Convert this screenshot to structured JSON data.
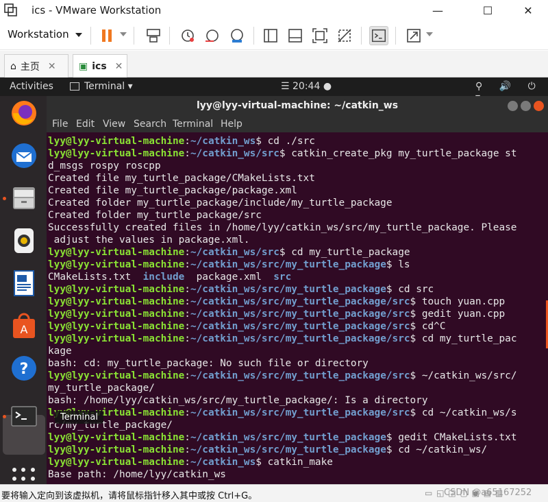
{
  "window": {
    "title": "ics - VMware Workstation"
  },
  "toolbar": {
    "workstation_label": "Workstation"
  },
  "tabs": [
    {
      "label": "主页",
      "close": "✕"
    },
    {
      "label": "ics",
      "close": "✕"
    }
  ],
  "ubuntu": {
    "activities": "Activities",
    "app_menu": "Terminal ▾",
    "clock": "20:44",
    "tray": "⚲ 🔊 ⏻ ▾"
  },
  "dock": {
    "tooltip": "Terminal"
  },
  "terminal": {
    "title": "lyy@lyy-virtual-machine: ~/catkin_ws",
    "menu": [
      "File",
      "Edit",
      "View",
      "Search",
      "Terminal",
      "Help"
    ],
    "lines": [
      [
        [
          "u",
          "lyy@lyy-virtual-machine"
        ],
        [
          "t",
          ":"
        ],
        [
          "p",
          "~/catkin_ws"
        ],
        [
          "t",
          "$ cd ./src"
        ]
      ],
      [
        [
          "u",
          "lyy@lyy-virtual-machine"
        ],
        [
          "t",
          ":"
        ],
        [
          "p",
          "~/catkin_ws/src"
        ],
        [
          "t",
          "$ catkin_create_pkg my_turtle_package st"
        ]
      ],
      [
        [
          "t",
          "d_msgs rospy roscpp"
        ]
      ],
      [
        [
          "t",
          "Created file my_turtle_package/CMakeLists.txt"
        ]
      ],
      [
        [
          "t",
          "Created file my_turtle_package/package.xml"
        ]
      ],
      [
        [
          "t",
          "Created folder my_turtle_package/include/my_turtle_package"
        ]
      ],
      [
        [
          "t",
          "Created folder my_turtle_package/src"
        ]
      ],
      [
        [
          "t",
          "Successfully created files in /home/lyy/catkin_ws/src/my_turtle_package. Please"
        ]
      ],
      [
        [
          "t",
          " adjust the values in package.xml."
        ]
      ],
      [
        [
          "u",
          "lyy@lyy-virtual-machine"
        ],
        [
          "t",
          ":"
        ],
        [
          "p",
          "~/catkin_ws/src"
        ],
        [
          "t",
          "$ cd my_turtle_package"
        ]
      ],
      [
        [
          "u",
          "lyy@lyy-virtual-machine"
        ],
        [
          "t",
          ":"
        ],
        [
          "p",
          "~/catkin_ws/src/my_turtle_package"
        ],
        [
          "t",
          "$ ls"
        ]
      ],
      [
        [
          "t",
          "CMakeLists.txt  "
        ],
        [
          "d",
          "include"
        ],
        [
          "t",
          "  package.xml  "
        ],
        [
          "d",
          "src"
        ]
      ],
      [
        [
          "u",
          "lyy@lyy-virtual-machine"
        ],
        [
          "t",
          ":"
        ],
        [
          "p",
          "~/catkin_ws/src/my_turtle_package"
        ],
        [
          "t",
          "$ cd src"
        ]
      ],
      [
        [
          "u",
          "lyy@lyy-virtual-machine"
        ],
        [
          "t",
          ":"
        ],
        [
          "p",
          "~/catkin_ws/src/my_turtle_package/src"
        ],
        [
          "t",
          "$ touch yuan.cpp"
        ]
      ],
      [
        [
          "u",
          "lyy@lyy-virtual-machine"
        ],
        [
          "t",
          ":"
        ],
        [
          "p",
          "~/catkin_ws/src/my_turtle_package/src"
        ],
        [
          "t",
          "$ gedit yuan.cpp"
        ]
      ],
      [
        [
          "u",
          "lyy@lyy-virtual-machine"
        ],
        [
          "t",
          ":"
        ],
        [
          "p",
          "~/catkin_ws/src/my_turtle_package/src"
        ],
        [
          "t",
          "$ cd^C"
        ]
      ],
      [
        [
          "u",
          "lyy@lyy-virtual-machine"
        ],
        [
          "t",
          ":"
        ],
        [
          "p",
          "~/catkin_ws/src/my_turtle_package/src"
        ],
        [
          "t",
          "$ cd my_turtle_pac"
        ]
      ],
      [
        [
          "t",
          "kage"
        ]
      ],
      [
        [
          "t",
          "bash: cd: my_turtle_package: No such file or directory"
        ]
      ],
      [
        [
          "u",
          "lyy@lyy-virtual-machine"
        ],
        [
          "t",
          ":"
        ],
        [
          "p",
          "~/catkin_ws/src/my_turtle_package/src"
        ],
        [
          "t",
          "$ ~/catkin_ws/src/"
        ]
      ],
      [
        [
          "t",
          "my_turtle_package/"
        ]
      ],
      [
        [
          "t",
          "bash: /home/lyy/catkin_ws/src/my_turtle_package/: Is a directory"
        ]
      ],
      [
        [
          "u",
          "lyy@lyy-virtual-machine"
        ],
        [
          "t",
          ":"
        ],
        [
          "p",
          "~/catkin_ws/src/my_turtle_package/src"
        ],
        [
          "t",
          "$ cd ~/catkin_ws/s"
        ]
      ],
      [
        [
          "t",
          "rc/my_turtle_package/"
        ]
      ],
      [
        [
          "u",
          "lyy@lyy-virtual-machine"
        ],
        [
          "t",
          ":"
        ],
        [
          "p",
          "~/catkin_ws/src/my_turtle_package"
        ],
        [
          "t",
          "$ gedit CMakeLists.txt"
        ]
      ],
      [
        [
          "u",
          "lyy@lyy-virtual-machine"
        ],
        [
          "t",
          ":"
        ],
        [
          "p",
          "~/catkin_ws/src/my_turtle_package"
        ],
        [
          "t",
          "$ cd ~/catkin_ws/"
        ]
      ],
      [
        [
          "u",
          "lyy@lyy-virtual-machine"
        ],
        [
          "t",
          ":"
        ],
        [
          "p",
          "~/catkin_ws"
        ],
        [
          "t",
          "$ catkin_make"
        ]
      ],
      [
        [
          "t",
          "Base path: /home/lyy/catkin_ws"
        ]
      ]
    ]
  },
  "statusbar": {
    "message": "要将输入定向到该虚拟机，请将鼠标指针移入其中或按 Ctrl+G。",
    "watermark": "CSDN @a65167252"
  },
  "colors": {
    "terminal_bg": "#300a24",
    "user": "#8ae234",
    "path": "#729fcf",
    "accent": "#e95420"
  }
}
